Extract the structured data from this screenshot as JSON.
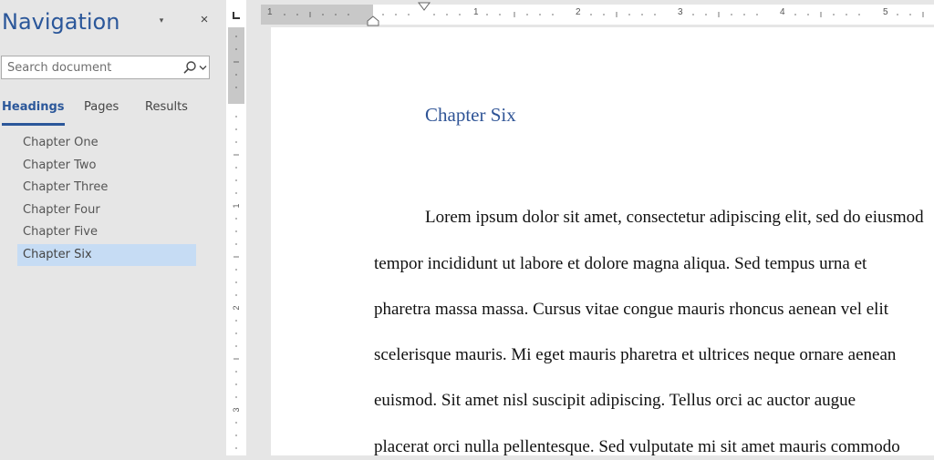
{
  "navigation": {
    "title": "Navigation",
    "options_glyph": "▾",
    "close_glyph": "×",
    "search": {
      "placeholder": "Search document",
      "value": ""
    },
    "tabs": [
      {
        "label": "Headings",
        "active": true
      },
      {
        "label": "Pages",
        "active": false
      },
      {
        "label": "Results",
        "active": false
      }
    ],
    "headings": [
      {
        "label": "Chapter One",
        "selected": false
      },
      {
        "label": "Chapter Two",
        "selected": false
      },
      {
        "label": "Chapter Three",
        "selected": false
      },
      {
        "label": "Chapter Four",
        "selected": false
      },
      {
        "label": "Chapter Five",
        "selected": false
      },
      {
        "label": "Chapter Six",
        "selected": true
      }
    ]
  },
  "rulers": {
    "horizontal_numbers": [
      "1",
      "1",
      "2",
      "3",
      "4",
      "5"
    ],
    "vertical_numbers": [
      "1",
      "2",
      "3"
    ]
  },
  "document": {
    "heading": "Chapter Six",
    "body_lines": [
      "Lorem ipsum dolor sit amet, consectetur adipiscing elit, sed do eiusmod",
      "tempor incididunt ut labore et dolore magna aliqua. Sed tempus urna et",
      "pharetra massa massa. Cursus vitae congue mauris rhoncus aenean vel elit",
      "scelerisque mauris. Mi eget mauris pharetra et ultrices neque ornare aenean",
      "euismod. Sit amet nisl suscipit adipiscing. Tellus orci ac auctor augue",
      "placerat orci nulla pellentesque. Sed vulputate mi sit amet mauris commodo"
    ]
  },
  "colors": {
    "accent": "#2b579a",
    "heading": "#2f5496",
    "selection": "#c6dcf4",
    "pane": "#e6e6e6"
  },
  "icons": [
    "search-icon",
    "chevron-down-icon",
    "close-icon",
    "tab-stop-icon",
    "indent-marker-icon"
  ]
}
